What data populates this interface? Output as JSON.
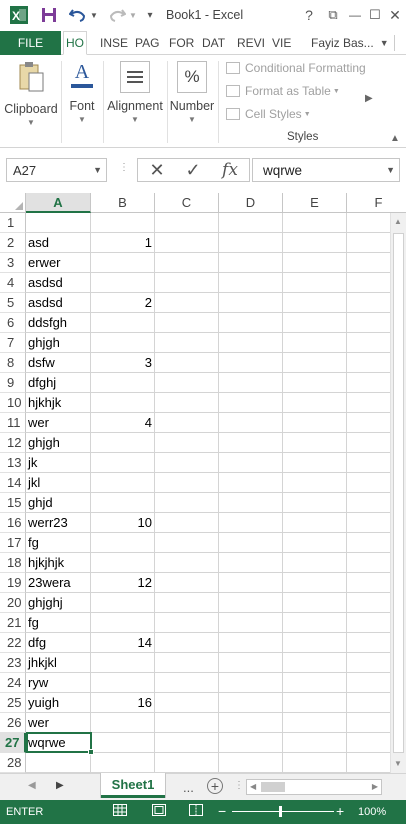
{
  "window": {
    "title": "Book1 - Excel",
    "help_label": "?",
    "restore_label": "⧉",
    "minimize_label": "—",
    "maximize_label": "☐",
    "close_label": "✕"
  },
  "ribbon_tabs": {
    "file": "FILE",
    "tabs": [
      "HO",
      "INSE",
      "PAG",
      "FOR",
      "DAT",
      "REVI",
      "VIE"
    ],
    "active": "HO",
    "user": "Fayiz Bas..."
  },
  "ribbon": {
    "clipboard": "Clipboard",
    "font": "Font",
    "alignment": "Alignment",
    "number": "Number",
    "number_icon_glyph": "%",
    "font_icon_glyph": "A",
    "conditional_formatting": "Conditional Formatting",
    "format_as_table": "Format as Table",
    "cell_styles": "Cell Styles",
    "styles_group": "Styles"
  },
  "formula_bar": {
    "name_box": "A27",
    "formula": "wqrwe",
    "cancel_glyph": "✕",
    "enter_glyph": "✓",
    "fx_glyph": "fx"
  },
  "sheet": {
    "columns": [
      "A",
      "B",
      "C",
      "D",
      "E",
      "F"
    ],
    "selected_column": "A",
    "selected_row": 27,
    "rows": [
      {
        "n": "1",
        "a": "",
        "b": ""
      },
      {
        "n": "2",
        "a": "asd",
        "b": "1"
      },
      {
        "n": "3",
        "a": "erwer",
        "b": ""
      },
      {
        "n": "4",
        "a": "asdsd",
        "b": ""
      },
      {
        "n": "5",
        "a": "asdsd",
        "b": "2"
      },
      {
        "n": "6",
        "a": "ddsfgh",
        "b": ""
      },
      {
        "n": "7",
        "a": "ghjgh",
        "b": ""
      },
      {
        "n": "8",
        "a": "dsfw",
        "b": "3"
      },
      {
        "n": "9",
        "a": "dfghj",
        "b": ""
      },
      {
        "n": "10",
        "a": "hjkhjk",
        "b": ""
      },
      {
        "n": "11",
        "a": "wer",
        "b": "4"
      },
      {
        "n": "12",
        "a": "ghjgh",
        "b": ""
      },
      {
        "n": "13",
        "a": "jk",
        "b": ""
      },
      {
        "n": "14",
        "a": "jkl",
        "b": ""
      },
      {
        "n": "15",
        "a": "ghjd",
        "b": ""
      },
      {
        "n": "16",
        "a": "werr23",
        "b": "10"
      },
      {
        "n": "17",
        "a": "fg",
        "b": ""
      },
      {
        "n": "18",
        "a": "hjkjhjk",
        "b": ""
      },
      {
        "n": "19",
        "a": "23wera",
        "b": "12"
      },
      {
        "n": "20",
        "a": "ghjghj",
        "b": ""
      },
      {
        "n": "21",
        "a": "fg",
        "b": ""
      },
      {
        "n": "22",
        "a": "dfg",
        "b": "14"
      },
      {
        "n": "23",
        "a": "jhkjkl",
        "b": ""
      },
      {
        "n": "24",
        "a": "ryw",
        "b": ""
      },
      {
        "n": "25",
        "a": "yuigh",
        "b": "16"
      },
      {
        "n": "26",
        "a": "wer",
        "b": ""
      },
      {
        "n": "27",
        "a": "wqrwe",
        "b": ""
      },
      {
        "n": "28",
        "a": "",
        "b": ""
      }
    ]
  },
  "sheet_tabs": {
    "active": "Sheet1",
    "more": "...",
    "add": "+"
  },
  "status": {
    "mode": "ENTER",
    "zoom": "100%",
    "zoom_minus": "−",
    "zoom_plus": "+"
  },
  "colors": {
    "excel_green": "#217346"
  }
}
